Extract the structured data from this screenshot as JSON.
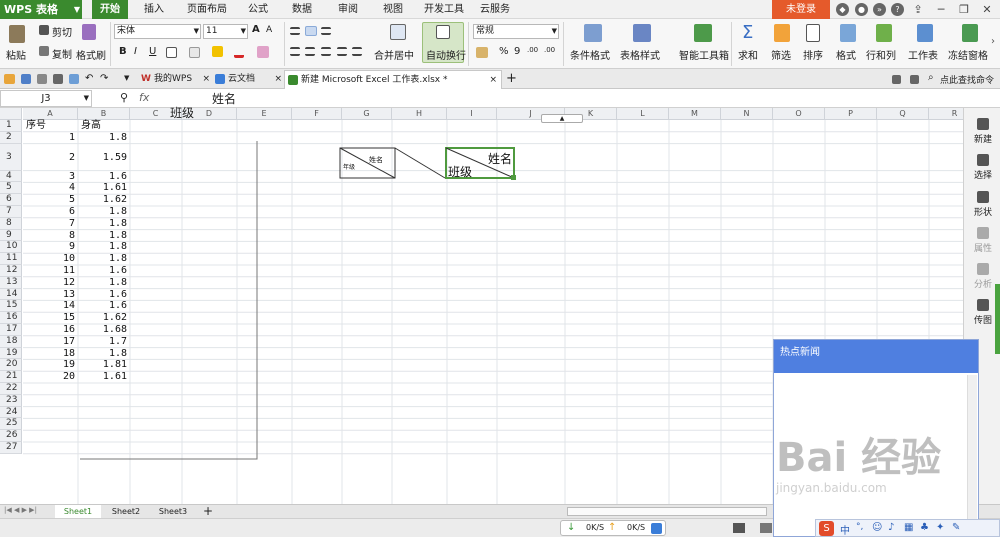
{
  "app": {
    "logo": "WPS 表格",
    "login": "未登录"
  },
  "menu_tabs": [
    "开始",
    "插入",
    "页面布局",
    "公式",
    "数据",
    "审阅",
    "视图",
    "开发工具",
    "云服务"
  ],
  "ribbon": {
    "paste": "粘贴",
    "cut": "剪切",
    "copy": "复制",
    "format_painter": "格式刷",
    "font_name": "宋体",
    "font_size": "11",
    "bold": "B",
    "italic": "I",
    "underline": "U",
    "font_grow": "A",
    "font_shrink": "A",
    "merge": "合并居中",
    "wrap": "自动换行",
    "number_format": "常规",
    "percent": "%",
    "thousands": "9",
    "dec_inc": ".00",
    "dec_dec": ".00",
    "cond_format": "条件格式",
    "table_style": "表格样式",
    "smart_toolbox": "智能工具箱",
    "sum": "求和",
    "filter": "筛选",
    "sort": "排序",
    "format": "格式",
    "row_col": "行和列",
    "worksheet": "工作表",
    "freeze": "冻结窗格"
  },
  "doc_tabs": [
    "我的WPS",
    "云文档",
    "新建 Microsoft Excel 工作表.xlsx *"
  ],
  "search_cmd": "点此查找命令",
  "formula_bar": {
    "name_box": "J3",
    "fx": "fx",
    "value_line1": "班级",
    "value_line2": "姓名"
  },
  "columns": [
    "A",
    "B",
    "C",
    "D",
    "E",
    "F",
    "G",
    "H",
    "I",
    "J",
    "K",
    "L",
    "M",
    "N",
    "O",
    "P",
    "Q",
    "R"
  ],
  "rows": [
    "1",
    "2",
    "3",
    "4",
    "5",
    "6",
    "7",
    "8",
    "9",
    "10",
    "11",
    "12",
    "13",
    "14",
    "15",
    "16",
    "17",
    "18",
    "19",
    "20",
    "21",
    "22",
    "23",
    "24",
    "25",
    "26",
    "27"
  ],
  "table": {
    "header_a": "序号",
    "header_b": "身高",
    "a": [
      "1",
      "2",
      "3",
      "4",
      "5",
      "6",
      "7",
      "8",
      "9",
      "10",
      "11",
      "12",
      "13",
      "14",
      "15",
      "16",
      "17",
      "18",
      "19",
      "20"
    ],
    "b": [
      "1.8",
      "1.59",
      "1.6",
      "1.61",
      "1.62",
      "1.8",
      "1.8",
      "1.8",
      "1.8",
      "1.8",
      "1.6",
      "1.8",
      "1.6",
      "1.6",
      "1.62",
      "1.68",
      "1.7",
      "1.8",
      "1.81",
      "1.61"
    ]
  },
  "diag_small": {
    "top": "姓名",
    "bottom": "年级"
  },
  "diag_big": {
    "top": "姓名",
    "bottom": "班级"
  },
  "sidebar": [
    "新建",
    "选择",
    "形状",
    "属性",
    "分析",
    "传图"
  ],
  "sheets": [
    "Sheet1",
    "Sheet2",
    "Sheet3",
    "+"
  ],
  "status": {
    "down": "0K/S",
    "up": "0K/S"
  },
  "news": {
    "title": "热点新闻"
  },
  "watermark": {
    "main": "Bai 经验",
    "url": "jingyan.baidu.com"
  },
  "colors": {
    "accent": "#3a8a2e",
    "login": "#e55a2b",
    "news": "#4f7fe0"
  }
}
